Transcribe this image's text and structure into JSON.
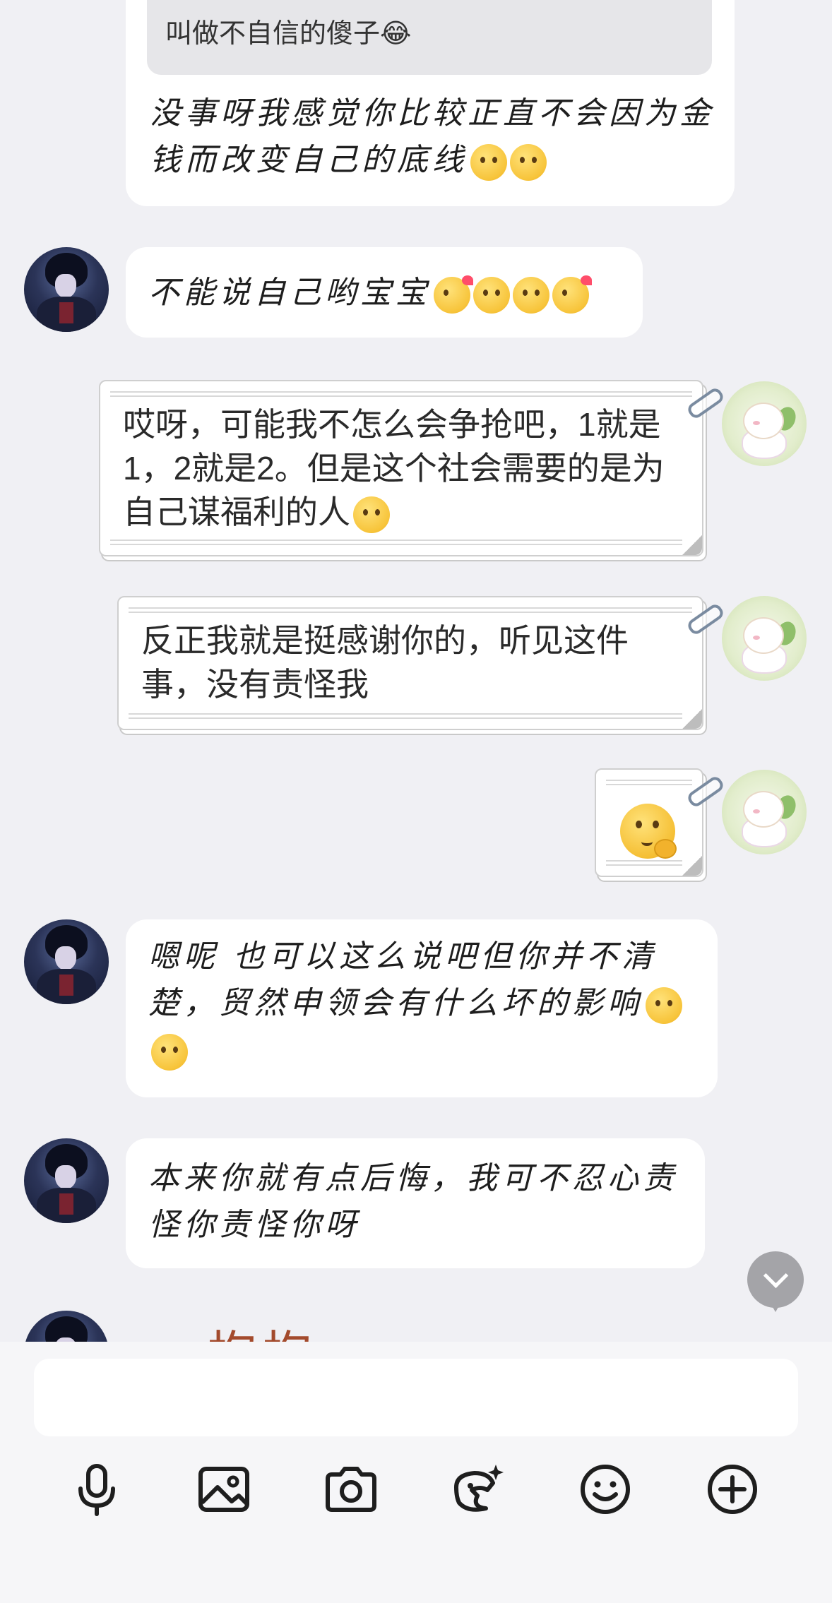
{
  "messages": [
    {
      "id": "m1",
      "side": "left",
      "quote": "叫做不自信的傻子😂",
      "text": "没事呀我感觉你比较正直不会因为金钱而改变自己的底线",
      "emojis": [
        "blush-hug",
        "blush-hug"
      ]
    },
    {
      "id": "m2",
      "side": "left",
      "text": "不能说自己哟宝宝",
      "emojis": [
        "heart-hug",
        "blush-hug",
        "starstruck",
        "heart-starstruck"
      ]
    },
    {
      "id": "m3",
      "side": "right",
      "text": "哎呀，可能我不怎么会争抢吧，1就是1，2就是2。但是这个社会需要的是为自己谋福利的人",
      "emojis": [
        "pleading"
      ]
    },
    {
      "id": "m4",
      "side": "right",
      "text": "反正我就是挺感谢你的，听见这件事，没有责怪我"
    },
    {
      "id": "m5",
      "side": "right",
      "sticker": "yummy-face"
    },
    {
      "id": "m6",
      "side": "left",
      "text": "嗯呢 也可以这么说吧但你并不清楚，贸然申领会有什么坏的影响",
      "emojis": [
        "thinking-shush",
        "thinking-shush"
      ]
    },
    {
      "id": "m7",
      "side": "left",
      "text": "本来你就有点后悔，我可不忍心责怪你责怪你呀"
    },
    {
      "id": "m8",
      "side": "left",
      "partial_text": "抱抱"
    }
  ],
  "composer": {
    "input_value": "",
    "tools": [
      "microphone-icon",
      "image-icon",
      "camera-icon",
      "sticker-icon",
      "emoji-icon",
      "plus-icon"
    ]
  },
  "colors": {
    "background": "#f0f0f4",
    "bubble": "#ffffff",
    "quote": "#e6e6e9",
    "scroll_button": "#a4a4a8"
  }
}
